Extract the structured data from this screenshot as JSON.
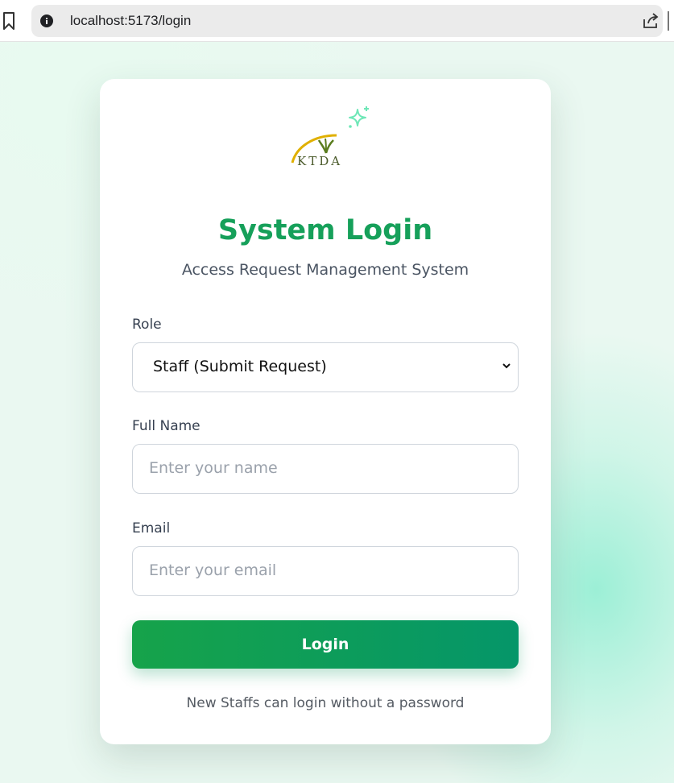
{
  "browser": {
    "url": "localhost:5173/login"
  },
  "logo": {
    "text": "KTDA",
    "icon": "ktda-leaf-logo"
  },
  "login": {
    "title": "System Login",
    "subtitle": "Access Request Management System",
    "role_label": "Role",
    "role_value": "Staff (Submit Request)",
    "name_label": "Full Name",
    "name_placeholder": "Enter your name",
    "email_label": "Email",
    "email_placeholder": "Enter your email",
    "button_label": "Login",
    "footer_note": "New Staffs can login without a password"
  },
  "colors": {
    "accent": "#16a05a",
    "button_start": "#16a34a",
    "button_end": "#059669",
    "sparkle": "#6ee7b7"
  }
}
